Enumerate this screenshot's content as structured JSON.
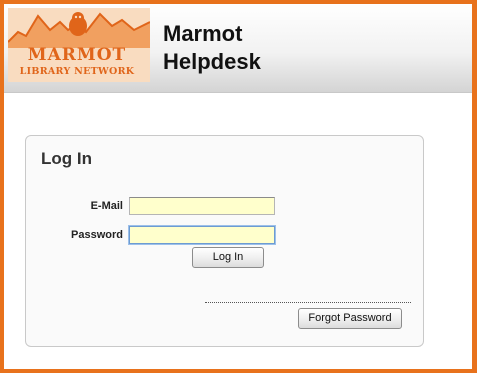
{
  "header": {
    "logo": {
      "line1": "MARMOT",
      "line2": "LIBRARY NETWORK"
    },
    "title_line1": "Marmot",
    "title_line2": "Helpdesk"
  },
  "login": {
    "heading": "Log In",
    "email_label": "E-Mail",
    "email_value": "",
    "password_label": "Password",
    "password_value": "",
    "login_button": "Log In",
    "forgot_button": "Forgot Password"
  },
  "colors": {
    "frame": "#e8721c",
    "logo_text": "#e0651a",
    "logo_background": "#f9dcc0",
    "input_background": "#ffffcc"
  }
}
